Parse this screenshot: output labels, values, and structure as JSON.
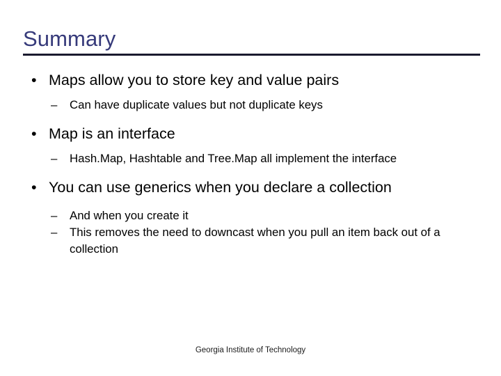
{
  "slide": {
    "title": "Summary",
    "title_color": "#363a7a",
    "rule_color": "#1a1a2e",
    "background_color": "#ffffff",
    "body_color": "#000000",
    "bullet_marker": "•",
    "dash_marker": "–",
    "bullets": [
      {
        "level1": "Maps allow you to store key and value pairs",
        "level2": [
          "Can have duplicate values but not duplicate keys"
        ]
      },
      {
        "level1": "Map is an interface",
        "level2": [
          "Hash.Map, Hashtable and Tree.Map all implement the interface"
        ]
      },
      {
        "level1": "You can use generics when you declare a collection",
        "level2": [
          "And when you create it",
          "This removes the need to downcast when you pull an item back out of a collection"
        ]
      }
    ],
    "footer": "Georgia Institute of Technology"
  }
}
